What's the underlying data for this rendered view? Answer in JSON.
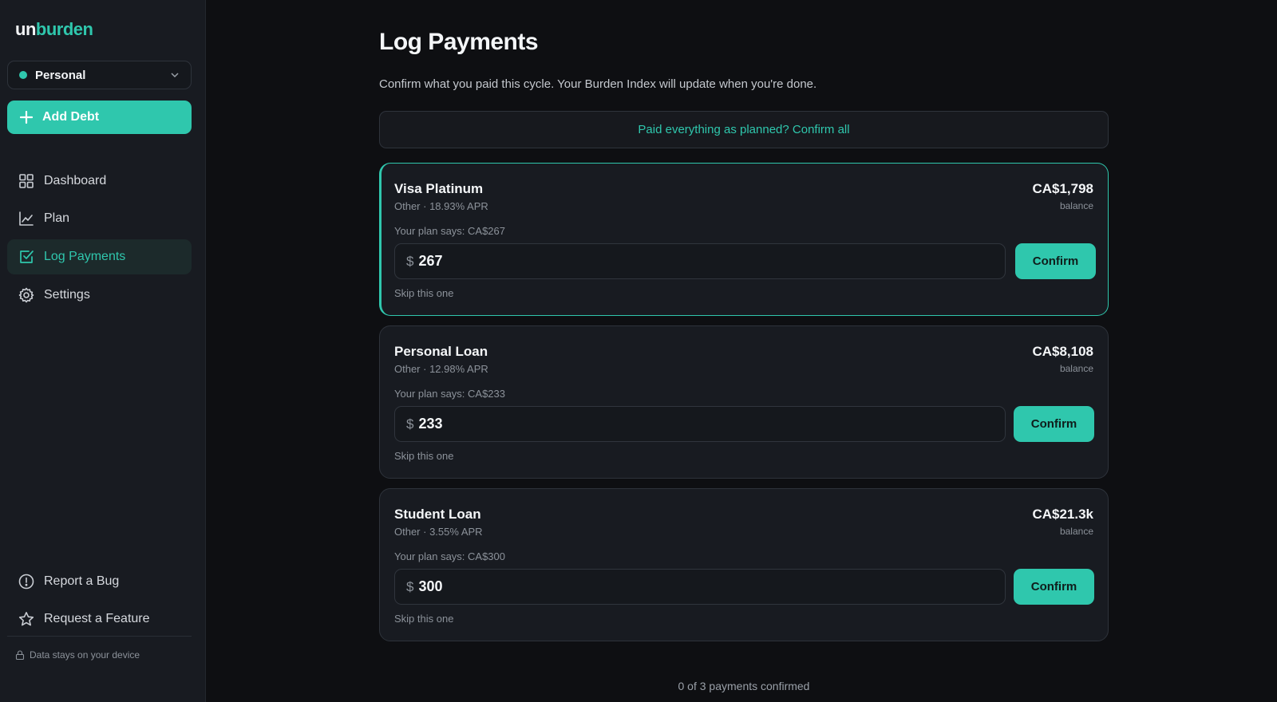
{
  "brand": {
    "prefix": "un",
    "suffix": "burden"
  },
  "profile": {
    "label": "Personal"
  },
  "sidebar": {
    "add_debt_label": "Add Debt",
    "items": [
      {
        "label": "Dashboard",
        "icon": "grid-icon"
      },
      {
        "label": "Plan",
        "icon": "chart-line-icon"
      },
      {
        "label": "Log Payments",
        "icon": "check-square-icon",
        "active": true
      },
      {
        "label": "Settings",
        "icon": "gear-icon"
      }
    ],
    "footer_items": [
      {
        "label": "Report a Bug",
        "icon": "alert-circle-icon"
      },
      {
        "label": "Request a Feature",
        "icon": "star-icon"
      }
    ],
    "device_note": "Data stays on your device"
  },
  "main": {
    "title": "Log Payments",
    "subtitle": "Confirm what you paid this cycle. Your Burden Index will update when you're done.",
    "confirm_all_label": "Paid everything as planned? Confirm all",
    "confirm_label": "Confirm",
    "skip_label": "Skip this one",
    "currency_symbol": "$",
    "balance_label": "balance",
    "debts": [
      {
        "name": "Visa Platinum",
        "meta": "Other · 18.93% APR",
        "balance": "CA$1,798",
        "plan": "Your plan says: CA$267",
        "amount": "267"
      },
      {
        "name": "Personal Loan",
        "meta": "Other · 12.98% APR",
        "balance": "CA$8,108",
        "plan": "Your plan says: CA$233",
        "amount": "233"
      },
      {
        "name": "Student Loan",
        "meta": "Other · 3.55% APR",
        "balance": "CA$21.3k",
        "plan": "Your plan says: CA$300",
        "amount": "300"
      }
    ],
    "progress_note": "0 of 3 payments confirmed"
  },
  "colors": {
    "accent": "#2fc7ad",
    "background": "#0e0f12",
    "sidebar": "#181b21",
    "card": "#181b21"
  }
}
